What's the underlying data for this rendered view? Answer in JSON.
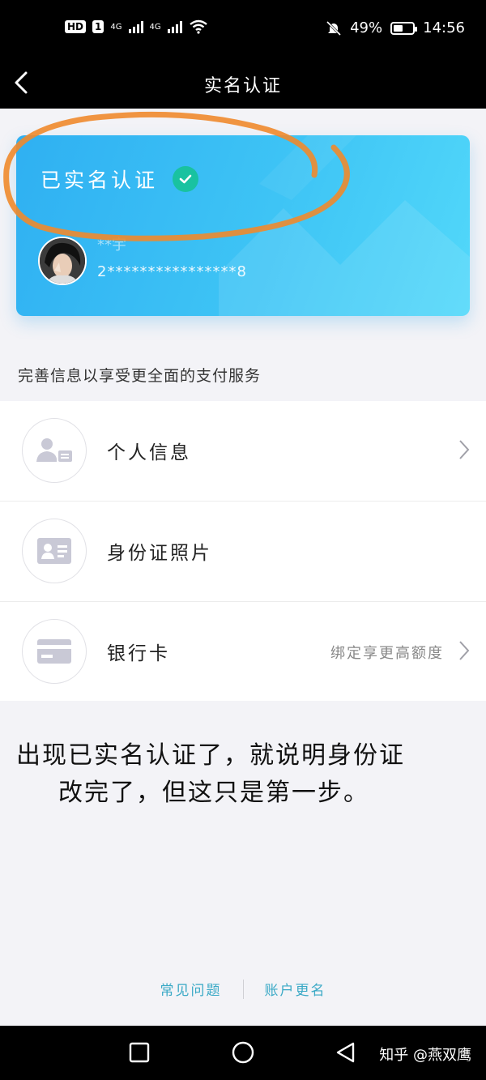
{
  "status_bar": {
    "hd": "HD",
    "sim": "1",
    "net1": "4G",
    "net2": "4G",
    "battery": "49%",
    "battery_level": 0.49,
    "time": "14:56"
  },
  "header": {
    "title": "实名认证"
  },
  "card": {
    "status": "已实名认证",
    "name": "**宇",
    "id_number": "2****************8",
    "accent": "#2fb0f2",
    "badge_color": "#19c2a0"
  },
  "hint": "完善信息以享受更全面的支付服务",
  "list": [
    {
      "label": "个人信息",
      "sub": "",
      "icon": "user-card-icon"
    },
    {
      "label": "身份证照片",
      "sub": "",
      "icon": "id-card-icon"
    },
    {
      "label": "银行卡",
      "sub": "绑定享更高额度",
      "icon": "bank-card-icon"
    }
  ],
  "note": {
    "line1": "出现已实名认证了，就说明身份证",
    "line2": "改完了，但这只是第一步。"
  },
  "footer": {
    "faq": "常见问题",
    "rename": "账户更名"
  },
  "watermark": "知乎 @燕双鹰"
}
